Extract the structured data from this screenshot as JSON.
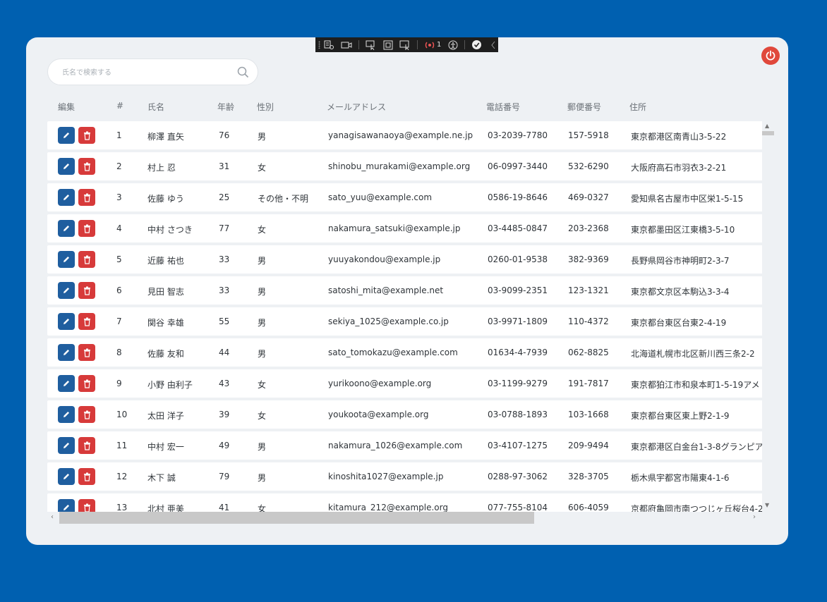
{
  "search": {
    "placeholder": "氏名で検索する"
  },
  "columns": [
    "編集",
    "#",
    "氏名",
    "年齢",
    "性別",
    "メールアドレス",
    "電話番号",
    "郵便番号",
    "住所"
  ],
  "rows": [
    {
      "no": "1",
      "name": "柳澤 直矢",
      "age": "76",
      "gender": "男",
      "email": "yanagisawanaoya@example.ne.jp",
      "phone": "03-2039-7780",
      "zip": "157-5918",
      "address": "東京都港区南青山3-5-22"
    },
    {
      "no": "2",
      "name": "村上 忍",
      "age": "31",
      "gender": "女",
      "email": "shinobu_murakami@example.org",
      "phone": "06-0997-3440",
      "zip": "532-6290",
      "address": "大阪府高石市羽衣3-2-21"
    },
    {
      "no": "3",
      "name": "佐藤 ゆう",
      "age": "25",
      "gender": "その他・不明",
      "email": "sato_yuu@example.com",
      "phone": "0586-19-8646",
      "zip": "469-0327",
      "address": "愛知県名古屋市中区栄1-5-15"
    },
    {
      "no": "4",
      "name": "中村 さつき",
      "age": "77",
      "gender": "女",
      "email": "nakamura_satsuki@example.jp",
      "phone": "03-4485-0847",
      "zip": "203-2368",
      "address": "東京都墨田区江東橋3-5-10"
    },
    {
      "no": "5",
      "name": "近藤 祐也",
      "age": "33",
      "gender": "男",
      "email": "yuuyakondou@example.jp",
      "phone": "0260-01-9538",
      "zip": "382-9369",
      "address": "長野県岡谷市神明町2-3-7"
    },
    {
      "no": "6",
      "name": "見田 智志",
      "age": "33",
      "gender": "男",
      "email": "satoshi_mita@example.net",
      "phone": "03-9099-2351",
      "zip": "123-1321",
      "address": "東京都文京区本駒込3-3-4"
    },
    {
      "no": "7",
      "name": "関谷 幸雄",
      "age": "55",
      "gender": "男",
      "email": "sekiya_1025@example.co.jp",
      "phone": "03-9971-1809",
      "zip": "110-4372",
      "address": "東京都台東区台東2-4-19"
    },
    {
      "no": "8",
      "name": "佐藤 友和",
      "age": "44",
      "gender": "男",
      "email": "sato_tomokazu@example.com",
      "phone": "01634-4-7939",
      "zip": "062-8825",
      "address": "北海道札幌市北区新川西三条2-2"
    },
    {
      "no": "9",
      "name": "小野 由利子",
      "age": "43",
      "gender": "女",
      "email": "yurikoono@example.org",
      "phone": "03-1199-9279",
      "zip": "191-7817",
      "address": "東京都狛江市和泉本町1-5-19アメ"
    },
    {
      "no": "10",
      "name": "太田 洋子",
      "age": "39",
      "gender": "女",
      "email": "youkoota@example.org",
      "phone": "03-0788-1893",
      "zip": "103-1668",
      "address": "東京都台東区東上野2-1-9"
    },
    {
      "no": "11",
      "name": "中村 宏一",
      "age": "49",
      "gender": "男",
      "email": "nakamura_1026@example.com",
      "phone": "03-4107-1275",
      "zip": "209-9494",
      "address": "東京都港区白金台1-3-8グランピア"
    },
    {
      "no": "12",
      "name": "木下 誠",
      "age": "79",
      "gender": "男",
      "email": "kinoshita1027@example.jp",
      "phone": "0288-97-3062",
      "zip": "328-3705",
      "address": "栃木県宇都宮市陽東4-1-6"
    },
    {
      "no": "13",
      "name": "北村 亜美",
      "age": "41",
      "gender": "女",
      "email": "kitamura_212@example.org",
      "phone": "077-755-8104",
      "zip": "606-4059",
      "address": "京都府亀岡市南つつじヶ丘桜台4-2"
    }
  ],
  "toolbar": {
    "hot_reload_count": "1"
  },
  "colors": {
    "edit": "#1f5e9f",
    "delete": "#d73a3a",
    "power": "#e0483b"
  }
}
